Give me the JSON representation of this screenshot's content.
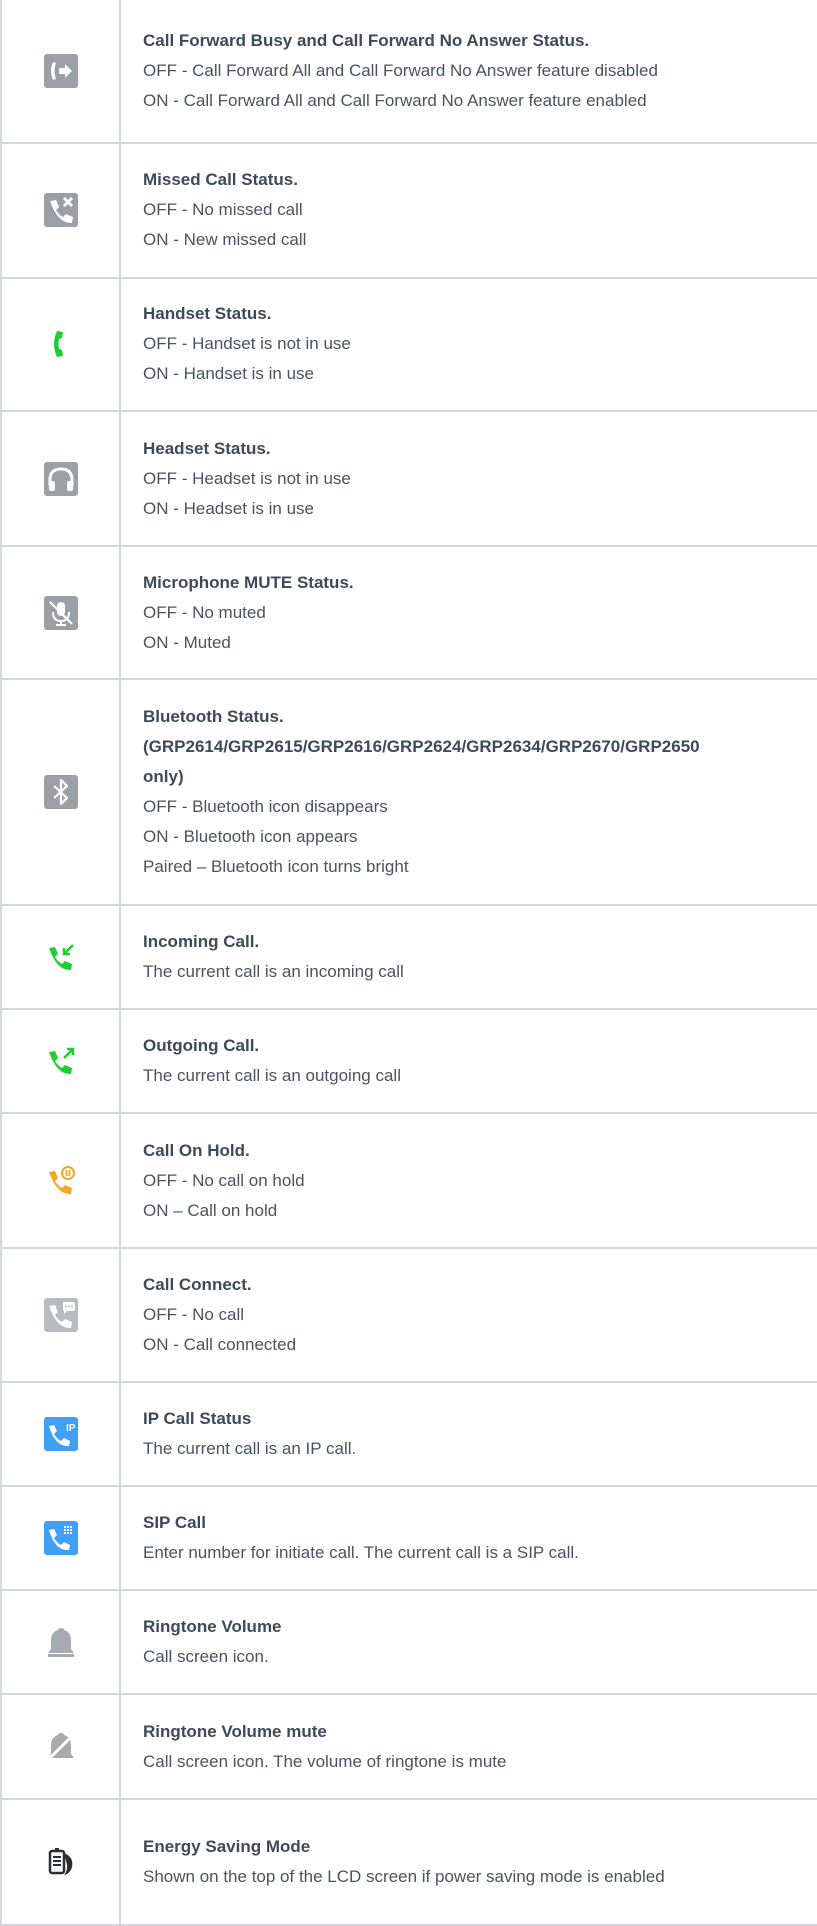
{
  "rows": [
    {
      "icon": "call-forward-icon",
      "title": "Call Forward Busy and Call Forward No Answer Status.",
      "lines": [
        "OFF - Call Forward All and Call Forward No Answer feature disabled",
        "ON - Call Forward All and Call Forward No Answer feature enabled"
      ]
    },
    {
      "icon": "missed-call-icon",
      "title": "Missed Call Status.",
      "lines": [
        "OFF - No missed call",
        "ON - New missed call"
      ]
    },
    {
      "icon": "handset-icon",
      "title": "Handset Status.",
      "lines": [
        "OFF - Handset is not in use",
        "ON - Handset is in use"
      ]
    },
    {
      "icon": "headset-icon",
      "title": "Headset Status.",
      "lines": [
        "OFF - Headset is not in use",
        "ON - Headset is in use"
      ]
    },
    {
      "icon": "microphone-mute-icon",
      "title": "Microphone MUTE Status.",
      "lines": [
        "OFF - No muted",
        "ON - Muted"
      ]
    },
    {
      "icon": "bluetooth-icon",
      "title": "Bluetooth Status.",
      "title2": "(GRP2614/GRP2615/GRP2616/GRP2624/GRP2634/GRP2670/GRP2650",
      "title3": "only)",
      "lines": [
        "OFF - Bluetooth icon disappears",
        "ON - Bluetooth icon appears",
        "Paired – Bluetooth icon turns bright"
      ]
    },
    {
      "icon": "incoming-call-icon",
      "title": "Incoming Call.",
      "lines": [
        "The current call is an incoming call"
      ]
    },
    {
      "icon": "outgoing-call-icon",
      "title": "Outgoing Call.",
      "lines": [
        "The current call is an outgoing call"
      ]
    },
    {
      "icon": "call-hold-icon",
      "title": "Call On Hold.",
      "lines": [
        "OFF - No call on hold",
        "ON – Call on hold"
      ]
    },
    {
      "icon": "call-connect-icon",
      "title": "Call Connect.",
      "lines": [
        "OFF - No call",
        "ON - Call connected"
      ]
    },
    {
      "icon": "ip-call-icon",
      "title": "IP Call Status",
      "icon_text": "IP",
      "lines": [
        "The current call is an IP call."
      ]
    },
    {
      "icon": "sip-call-icon",
      "title": "SIP Call",
      "lines": [
        "Enter number for initiate call. The current call is a SIP call."
      ]
    },
    {
      "icon": "ringtone-volume-icon",
      "title": "Ringtone Volume",
      "lines": [
        "Call screen icon."
      ]
    },
    {
      "icon": "ringtone-mute-icon",
      "title": "Ringtone Volume mute",
      "lines": [
        "Call screen icon. The volume of ringtone is mute"
      ]
    },
    {
      "icon": "energy-saving-icon",
      "title": "Energy Saving Mode",
      "lines": [
        "Shown on the top of the LCD screen if power saving mode is enabled"
      ]
    }
  ],
  "colors": {
    "border": "#d4d7dc",
    "title_text": "#3e4a5a",
    "body_text": "#4a5361",
    "green_icon": "#22cc33",
    "orange_icon": "#f5a623",
    "blue_icon": "#3fa0f5",
    "gray_icon": "#8a8d91"
  }
}
